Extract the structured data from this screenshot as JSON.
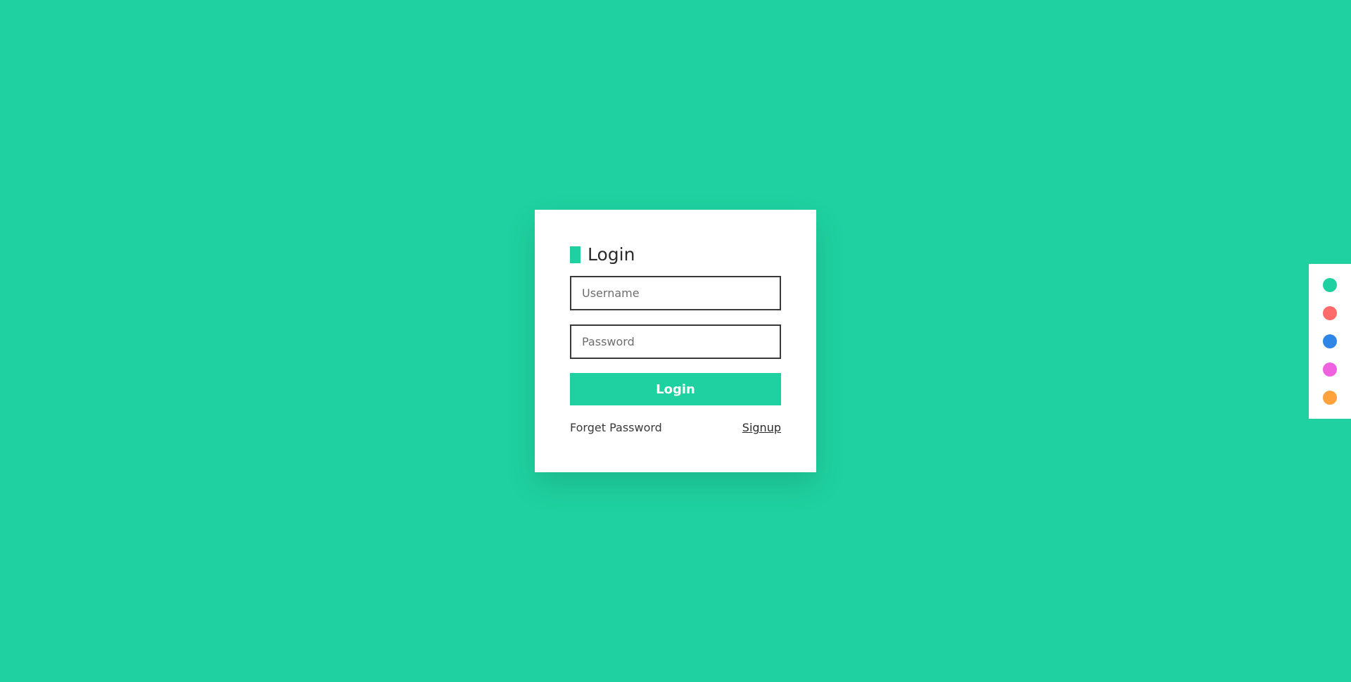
{
  "login_form": {
    "title": "Login",
    "username": {
      "placeholder": "Username",
      "value": ""
    },
    "password": {
      "placeholder": "Password",
      "value": ""
    },
    "submit_label": "Login",
    "forget_password_label": "Forget Password",
    "signup_label": "Signup"
  },
  "theme_switcher": {
    "colors": [
      "#1fd1a0",
      "#ff6b6b",
      "#2f86e6",
      "#ee62e0",
      "#ffa13d"
    ]
  },
  "colors": {
    "accent": "#1fd1a0",
    "background": "#1fd1a0",
    "card": "#ffffff"
  }
}
